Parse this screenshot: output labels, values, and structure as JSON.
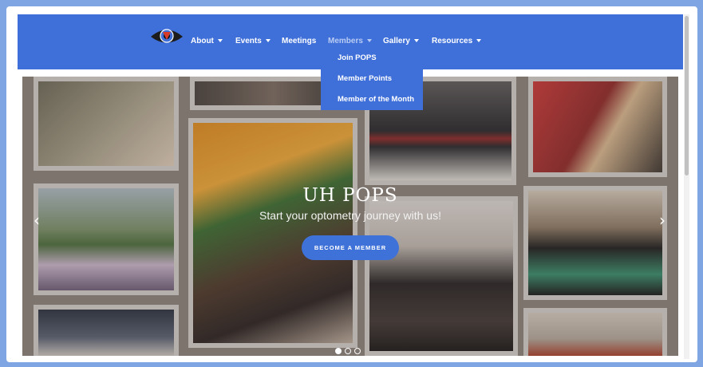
{
  "nav": {
    "items": [
      {
        "label": "About",
        "caret": true
      },
      {
        "label": "Events",
        "caret": true
      },
      {
        "label": "Meetings",
        "caret": false
      },
      {
        "label": "Members",
        "caret": true,
        "active": true
      },
      {
        "label": "Gallery",
        "caret": true
      },
      {
        "label": "Resources",
        "caret": true
      }
    ],
    "dropdown": [
      "Join POPS",
      "Member Points",
      "Member of the Month"
    ]
  },
  "hero": {
    "title": "UH POPS",
    "subtitle": "Start your optometry journey with us!",
    "button": "BECOME A MEMBER",
    "prev_icon": "chevron-left-icon",
    "next_icon": "chevron-right-icon",
    "slides": 3,
    "active_slide": 1
  },
  "colors": {
    "nav_bg": "#3f6fd9",
    "page_bg": "#7fa6e3",
    "button_bg": "#3f72d8"
  }
}
